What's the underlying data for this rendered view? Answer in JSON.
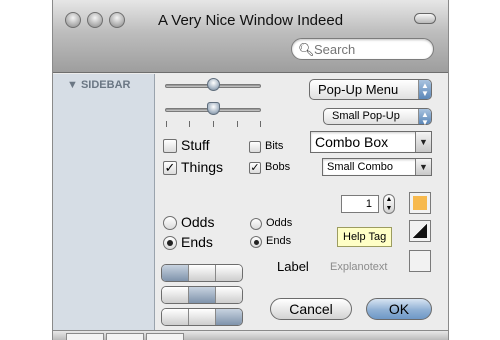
{
  "window": {
    "title": "A Very Nice Window Indeed"
  },
  "search": {
    "placeholder": "Search",
    "value": ""
  },
  "sidebar": {
    "heading": "SIDEBAR"
  },
  "sliders": [
    {
      "value": 0.5
    },
    {
      "value": 0.5
    }
  ],
  "checkboxes": [
    {
      "label": "Stuff",
      "checked": false
    },
    {
      "label": "Things",
      "checked": true
    },
    {
      "label": "Bits",
      "checked": false
    },
    {
      "label": "Bobs",
      "checked": true
    }
  ],
  "popups": {
    "popup_menu": "Pop-Up Menu",
    "small_popup": "Small Pop-Up",
    "combo_box": "Combo Box",
    "small_combo": "Small Combo"
  },
  "radios": {
    "large": [
      {
        "label": "Odds",
        "selected": false
      },
      {
        "label": "Ends",
        "selected": true
      }
    ],
    "small": [
      {
        "label": "Odds",
        "selected": false
      },
      {
        "label": "Ends",
        "selected": true
      }
    ]
  },
  "stepper": {
    "value": "1"
  },
  "help_tag": "Help Tag",
  "label_row": {
    "label": "Label",
    "explanation": "Explanotext"
  },
  "buttons": {
    "cancel": "Cancel",
    "ok": "OK"
  },
  "colors": {
    "well_orange": "#f7b94d",
    "default_button": "#8fb0d4",
    "sidebar_bg": "#d6dde5"
  }
}
